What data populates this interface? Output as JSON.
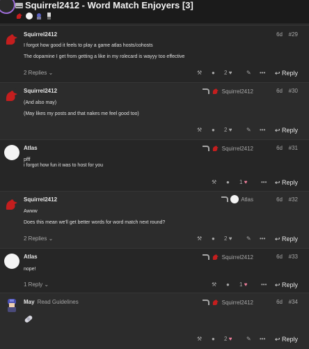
{
  "topic": {
    "title": "Squirrel2412 - Word Match Enjoyers [3]"
  },
  "colors": {
    "background": "#222222",
    "accent_heart": "#f07f9c",
    "squirrel_red": "#c41e1e"
  },
  "posts": [
    {
      "username": "Squirrel2412",
      "badge": "",
      "reply_to": "",
      "date": "6d",
      "number": "#29",
      "lines": [
        "I forgot how good it feels to play a game atlas hosts/cohosts",
        "The dopamine I get from getting a like in my rolecard is wayyy too effective"
      ],
      "replies": "2 Replies",
      "likes": "2",
      "liked": false,
      "reply_label": "Reply"
    },
    {
      "username": "Squirrel2412",
      "badge": "",
      "reply_to": "Squirrel2412",
      "date": "6d",
      "number": "#30",
      "lines": [
        "(And also may)",
        "(May likes my posts and that nakes me feel good too)"
      ],
      "replies": "",
      "likes": "2",
      "liked": false,
      "reply_label": "Reply"
    },
    {
      "username": "Atlas",
      "badge": "",
      "reply_to": "Squirrel2412",
      "date": "6d",
      "number": "#31",
      "lines": [
        "pfff",
        "i forgot how fun it was to host for you"
      ],
      "replies": "",
      "likes": "1",
      "liked": true,
      "reply_label": "Reply"
    },
    {
      "username": "Squirrel2412",
      "badge": "",
      "reply_to": "Atlas",
      "date": "6d",
      "number": "#32",
      "lines": [
        "Awww",
        "Does this mean we'll get better words for word match next round?"
      ],
      "replies": "2 Replies",
      "likes": "2",
      "liked": false,
      "reply_label": "Reply"
    },
    {
      "username": "Atlas",
      "badge": "",
      "reply_to": "Squirrel2412",
      "date": "6d",
      "number": "#33",
      "lines": [
        "nope!"
      ],
      "replies": "1 Reply",
      "likes": "1",
      "liked": true,
      "reply_label": "Reply"
    },
    {
      "username": "May",
      "badge": "Read Guidelines",
      "reply_to": "Squirrel2412",
      "date": "6d",
      "number": "#34",
      "lines": [],
      "replies": "",
      "likes": "2",
      "liked": true,
      "reply_label": "Reply"
    }
  ]
}
